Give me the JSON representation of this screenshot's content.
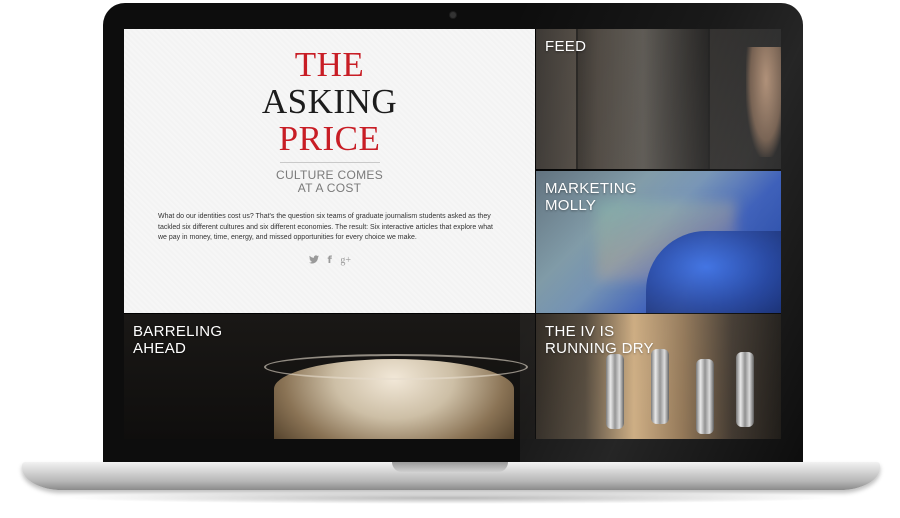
{
  "intro": {
    "title_line1": "THE",
    "title_line2": "ASKING",
    "title_line3": "PRICE",
    "tagline": "CULTURE COMES\nAT A COST",
    "description": "What do our identities cost us? That's the question six teams of graduate journalism students asked as they tackled six different cultures and six different economies. The result: Six interactive articles that explore what we pay in money, time, energy, and missed opportunities for every choice we make.",
    "social": [
      {
        "name": "twitter-icon",
        "glyph": "🐦"
      },
      {
        "name": "facebook-icon",
        "glyph": "f"
      },
      {
        "name": "google-plus-icon",
        "glyph": "g+"
      }
    ]
  },
  "panels": {
    "feed": {
      "title": "FEED"
    },
    "marketing": {
      "title": "MARKETING\nMOLLY"
    },
    "barreling": {
      "title": "BARRELING\nAHEAD"
    },
    "ivdry": {
      "title": "THE IV IS\nRUNNING DRY"
    }
  },
  "colors": {
    "accent_red": "#c81d25",
    "title_dark": "#1c1c1c",
    "muted_gray": "#7a7a7a"
  }
}
